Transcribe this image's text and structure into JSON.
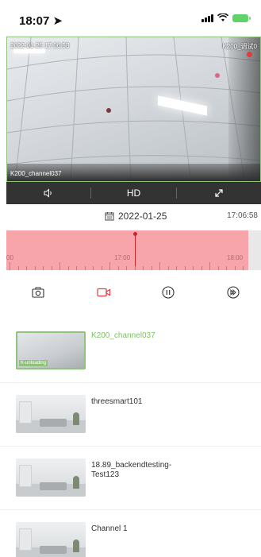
{
  "status_bar": {
    "time": "18:07"
  },
  "live_view": {
    "timestamp_left": "2022-01-25 17:06:58",
    "timestamp_right": "K200_调试0",
    "channel_label": "K200_channel037",
    "controls": {
      "audio_icon": "speaker-icon",
      "quality_label": "HD",
      "fullscreen_icon": "expand-icon"
    }
  },
  "playback": {
    "date": "2022-01-25",
    "current_time": "17:06:58",
    "timeline_labels": [
      "00",
      "17:00",
      "18:00"
    ]
  },
  "actions": [
    "camera-icon",
    "record-icon",
    "pause-icon",
    "fast-forward-icon"
  ],
  "colors": {
    "accent_green": "#7cc35e",
    "record_red": "#e23b3b",
    "timeline_pink": "#f7a4aa"
  },
  "channels": [
    {
      "name": "K200_channel037",
      "active": true,
      "thumb_label": "K-unloading"
    },
    {
      "name": "threesmart101",
      "active": false
    },
    {
      "name": "18.89_backendtesting-Test123",
      "active": false
    },
    {
      "name": "Channel 1",
      "active": false
    }
  ]
}
